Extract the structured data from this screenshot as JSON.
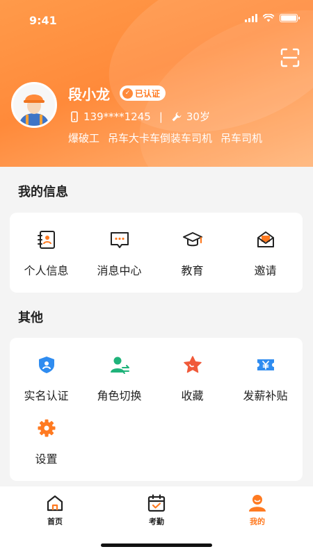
{
  "status_bar": {
    "time": "9:41"
  },
  "profile": {
    "name": "段小龙",
    "verified_label": "已认证",
    "phone": "139****1245",
    "age": "30岁",
    "jobs": [
      "爆破工",
      "吊车大卡车倒装车司机",
      "吊车司机"
    ]
  },
  "my_info": {
    "title": "我的信息",
    "items": [
      {
        "label": "个人信息",
        "icon": "contact-book-icon"
      },
      {
        "label": "消息中心",
        "icon": "message-icon"
      },
      {
        "label": "教育",
        "icon": "graduation-cap-icon"
      },
      {
        "label": "邀请",
        "icon": "invite-envelope-icon"
      }
    ]
  },
  "others": {
    "title": "其他",
    "items": [
      {
        "label": "实名认证",
        "icon": "id-shield-icon"
      },
      {
        "label": "角色切换",
        "icon": "role-switch-icon"
      },
      {
        "label": "收藏",
        "icon": "star-icon"
      },
      {
        "label": "发薪补贴",
        "icon": "yen-ticket-icon"
      },
      {
        "label": "设置",
        "icon": "gear-icon"
      }
    ]
  },
  "tabbar": {
    "tabs": [
      {
        "label": "首页",
        "icon": "home-icon"
      },
      {
        "label": "考勤",
        "icon": "calendar-check-icon"
      },
      {
        "label": "我的",
        "icon": "user-icon"
      }
    ],
    "active": "我的"
  },
  "colors": {
    "accent": "#ff7a21",
    "header_start": "#ff9a4a",
    "header_end": "#ffb57a",
    "green": "#1fb37a",
    "blue": "#2f8cf0",
    "red": "#f05a3a"
  }
}
